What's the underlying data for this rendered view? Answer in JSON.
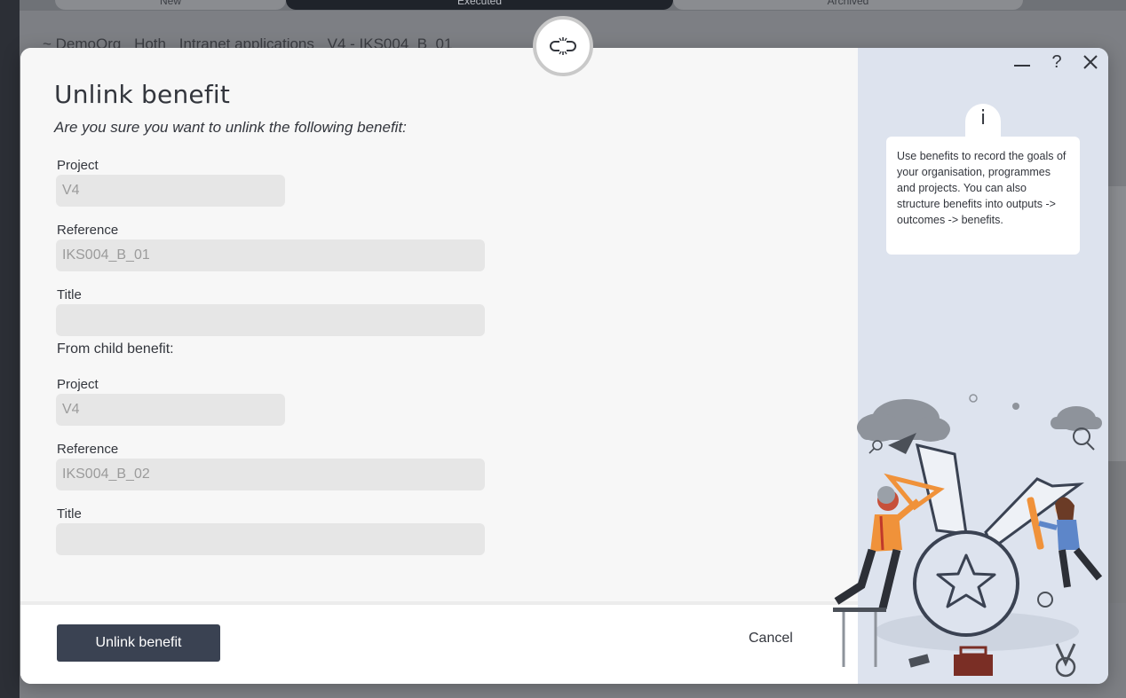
{
  "background": {
    "tabs": [
      "New",
      "Executed",
      "Archived"
    ],
    "breadcrumb": [
      "~ DemoOrg",
      "Hoth",
      "Intranet applications",
      "V4 - IKS004_B_01"
    ]
  },
  "dialog": {
    "title": "Unlink benefit",
    "subtitle": "Are you sure you want to unlink the following benefit:",
    "parent": {
      "project_label": "Project",
      "project_value": "V4",
      "reference_label": "Reference",
      "reference_value": "IKS004_B_01",
      "title_label": "Title",
      "title_value": ""
    },
    "child_section_label": "From child benefit:",
    "child": {
      "project_label": "Project",
      "project_value": "V4",
      "reference_label": "Reference",
      "reference_value": "IKS004_B_02",
      "title_label": "Title",
      "title_value": ""
    },
    "footer": {
      "primary_label": "Unlink benefit",
      "cancel_label": "Cancel"
    }
  },
  "window_controls": {
    "minimize": "minimize-icon",
    "help": "?",
    "close": "close-icon"
  },
  "help_panel": {
    "info_glyph": "i",
    "text": "Use benefits to record the goals of your organisation, programmes and projects. You can also structure benefits into outputs -> outcomes -> benefits."
  },
  "colors": {
    "primary_button": "#3a4252",
    "help_panel_bg": "#dde3ee",
    "field_bg": "#e6e6e6",
    "accent_orange": "#f0923a"
  }
}
